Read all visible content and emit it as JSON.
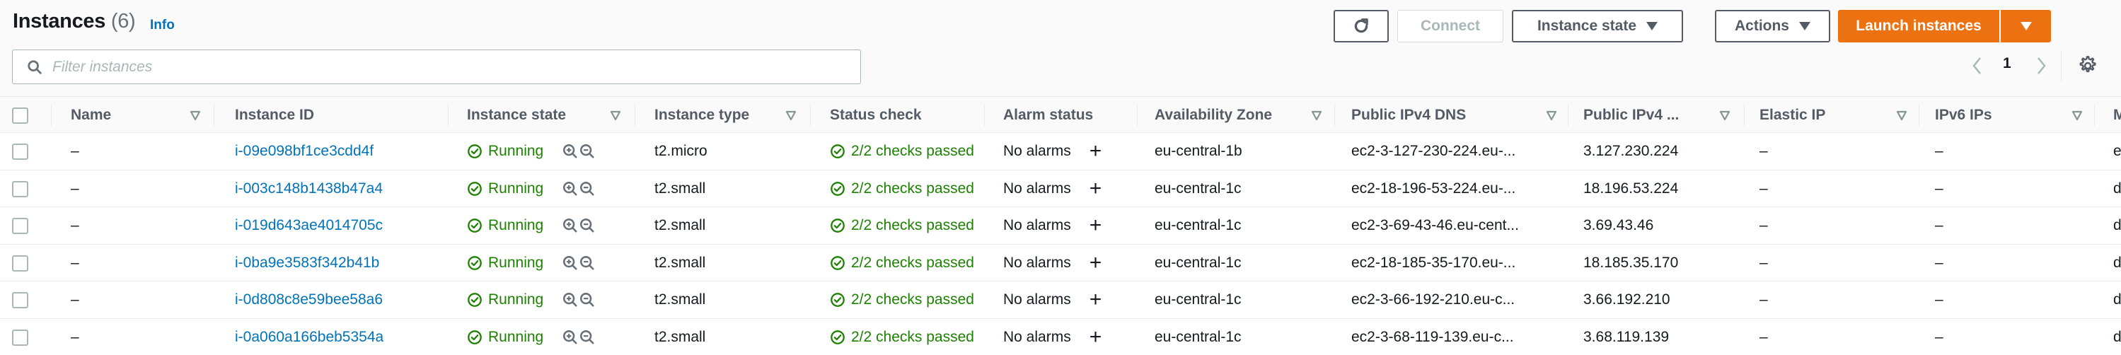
{
  "header": {
    "title": "Instances",
    "count": "(6)",
    "info_label": "Info"
  },
  "toolbar": {
    "refresh_icon": "refresh-icon",
    "connect_label": "Connect",
    "instance_state_label": "Instance state",
    "actions_label": "Actions",
    "launch_label": "Launch instances"
  },
  "filter": {
    "placeholder": "Filter instances",
    "value": ""
  },
  "pagination": {
    "current_page": "1"
  },
  "colors": {
    "accent": "#ec7211",
    "link": "#0073bb",
    "success": "#1d8102"
  },
  "table": {
    "columns": [
      {
        "label": "Name"
      },
      {
        "label": "Instance ID"
      },
      {
        "label": "Instance state"
      },
      {
        "label": "Instance type"
      },
      {
        "label": "Status check"
      },
      {
        "label": "Alarm status"
      },
      {
        "label": "Availability Zone"
      },
      {
        "label": "Public IPv4 DNS"
      },
      {
        "label": "Public IPv4 ..."
      },
      {
        "label": "Elastic IP"
      },
      {
        "label": "IPv6 IPs"
      },
      {
        "label": "M"
      }
    ],
    "rows": [
      {
        "name": "–",
        "id": "i-09e098bf1ce3cdd4f",
        "state": "Running",
        "type": "t2.micro",
        "status": "2/2 checks passed",
        "alarm": "No alarms",
        "az": "eu-central-1b",
        "dns": "ec2-3-127-230-224.eu-...",
        "ipv4": "3.127.230.224",
        "eip": "–",
        "ipv6": "–",
        "mon": "e"
      },
      {
        "name": "–",
        "id": "i-003c148b1438b47a4",
        "state": "Running",
        "type": "t2.small",
        "status": "2/2 checks passed",
        "alarm": "No alarms",
        "az": "eu-central-1c",
        "dns": "ec2-18-196-53-224.eu-...",
        "ipv4": "18.196.53.224",
        "eip": "–",
        "ipv6": "–",
        "mon": "d"
      },
      {
        "name": "–",
        "id": "i-019d643ae4014705c",
        "state": "Running",
        "type": "t2.small",
        "status": "2/2 checks passed",
        "alarm": "No alarms",
        "az": "eu-central-1c",
        "dns": "ec2-3-69-43-46.eu-cent...",
        "ipv4": "3.69.43.46",
        "eip": "–",
        "ipv6": "–",
        "mon": "d"
      },
      {
        "name": "–",
        "id": "i-0ba9e3583f342b41b",
        "state": "Running",
        "type": "t2.small",
        "status": "2/2 checks passed",
        "alarm": "No alarms",
        "az": "eu-central-1c",
        "dns": "ec2-18-185-35-170.eu-...",
        "ipv4": "18.185.35.170",
        "eip": "–",
        "ipv6": "–",
        "mon": "d"
      },
      {
        "name": "–",
        "id": "i-0d808c8e59bee58a6",
        "state": "Running",
        "type": "t2.small",
        "status": "2/2 checks passed",
        "alarm": "No alarms",
        "az": "eu-central-1c",
        "dns": "ec2-3-66-192-210.eu-c...",
        "ipv4": "3.66.192.210",
        "eip": "–",
        "ipv6": "–",
        "mon": "d"
      },
      {
        "name": "–",
        "id": "i-0a060a166beb5354a",
        "state": "Running",
        "type": "t2.small",
        "status": "2/2 checks passed",
        "alarm": "No alarms",
        "az": "eu-central-1c",
        "dns": "ec2-3-68-119-139.eu-c...",
        "ipv4": "3.68.119.139",
        "eip": "–",
        "ipv6": "–",
        "mon": "d"
      }
    ]
  }
}
